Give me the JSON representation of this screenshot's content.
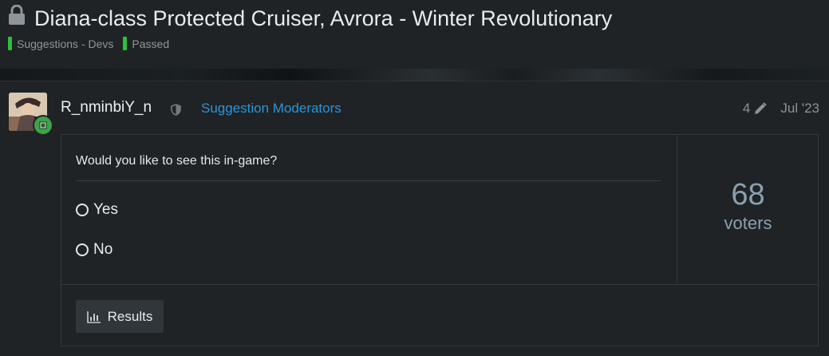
{
  "topic": {
    "title": "Diana-class Protected Cruiser, Avrora - Winter Revolutionary",
    "categories": [
      {
        "name": "Suggestions - Devs",
        "color": "#2fbf3b"
      },
      {
        "name": "Passed",
        "color": "#2fbf3b"
      }
    ]
  },
  "post": {
    "username": "R_nminbiY_n",
    "group": "Suggestion Moderators",
    "edit_count": "4",
    "date": "Jul '23"
  },
  "poll": {
    "question": "Would you like to see this in-game?",
    "options": [
      {
        "label": "Yes"
      },
      {
        "label": "No"
      }
    ],
    "voters_count": "68",
    "voters_label": "voters",
    "results_button": "Results"
  },
  "colors": {
    "background": "#1f2326",
    "link": "#2b95d6",
    "category": "#2fbf3b",
    "voters": "#8ba0ad"
  }
}
